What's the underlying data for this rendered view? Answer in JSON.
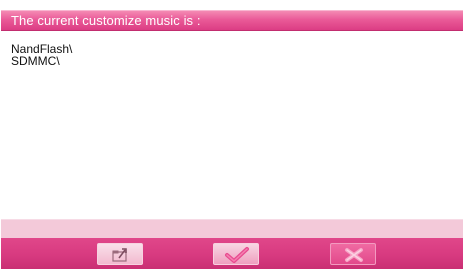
{
  "title": "The current customize music is :",
  "paths": [
    "NandFlash\\",
    "SDMMC\\"
  ],
  "toolbar": {
    "buttons": [
      {
        "name": "upload",
        "icon": "folder-upload-icon"
      },
      {
        "name": "confirm",
        "icon": "checkmark-icon"
      },
      {
        "name": "cancel",
        "icon": "cancel-icon"
      }
    ]
  },
  "colors": {
    "accent": "#e04f92",
    "title_bar": "#ea5a98",
    "status_strip": "#f3c9d9",
    "bottom_bar": "#d83a80"
  }
}
